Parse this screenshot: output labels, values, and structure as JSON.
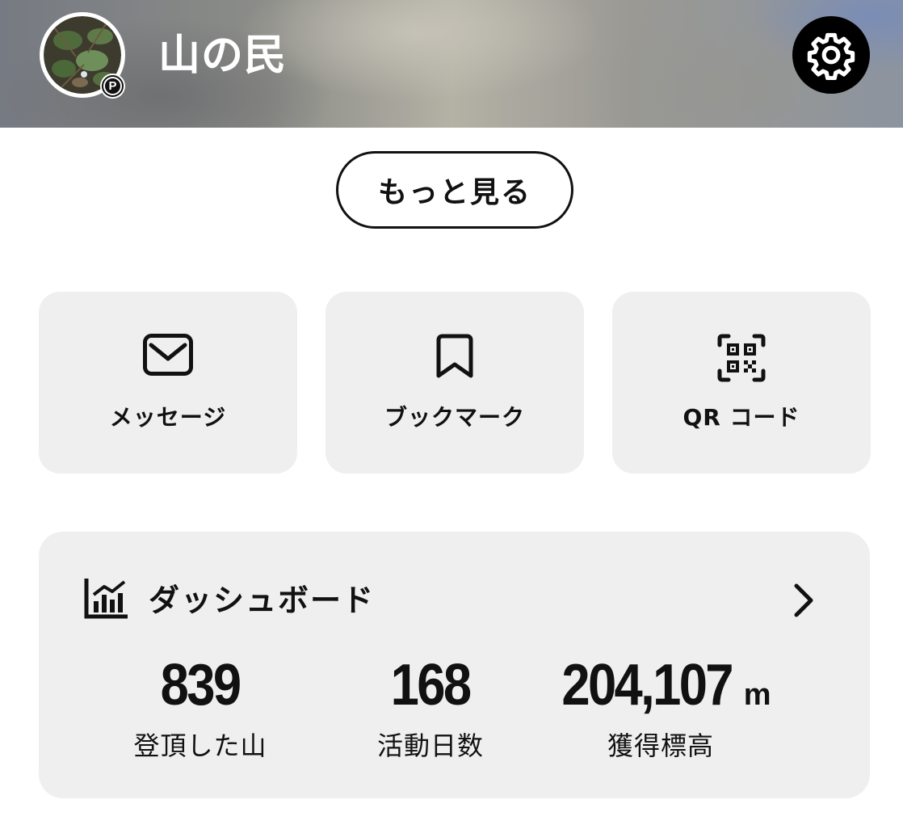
{
  "profile": {
    "name": "山の民",
    "badge": "P"
  },
  "actions": {
    "more_label": "もっと見る"
  },
  "tiles": [
    {
      "label": "メッセージ",
      "icon": "mail-icon"
    },
    {
      "label": "ブックマーク",
      "icon": "bookmark-icon"
    },
    {
      "label": "QR コード",
      "icon": "qr-code-icon"
    }
  ],
  "dashboard": {
    "title": "ダッシュボード",
    "icon": "bar-chart-icon",
    "stats": [
      {
        "value": "839",
        "unit": "",
        "label": "登頂した山"
      },
      {
        "value": "168",
        "unit": "",
        "label": "活動日数"
      },
      {
        "value": "204,107",
        "unit": "m",
        "label": "獲得標高"
      }
    ]
  },
  "colors": {
    "background": "#ffffff",
    "card": "#efefef",
    "text": "#111111",
    "settings_button": "#000000"
  }
}
